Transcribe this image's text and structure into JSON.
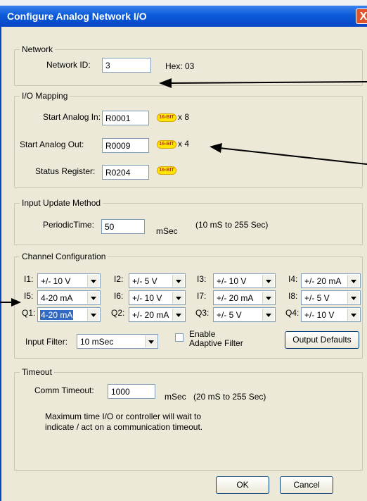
{
  "window": {
    "title": "Configure Analog Network I/O",
    "close_glyph": "X"
  },
  "network": {
    "legend": "Network",
    "id_label": "Network ID:",
    "id_value": "3",
    "hex_label": "Hex: 03"
  },
  "io_mapping": {
    "legend": "I/O Mapping",
    "rows": [
      {
        "label": "Start Analog In:",
        "value": "R0001",
        "badge": "16-BIT",
        "count": "x 8"
      },
      {
        "label": "Start Analog Out:",
        "value": "R0009",
        "badge": "16-BIT",
        "count": "x 4"
      },
      {
        "label": "Status Register:",
        "value": "R0204",
        "badge": "16-BIT",
        "count": ""
      }
    ]
  },
  "input_update": {
    "legend": "Input Update Method",
    "label": "PeriodicTime:",
    "value": "50",
    "unit": "mSec",
    "range": "(10 mS to 255 Sec)"
  },
  "channels": {
    "legend": "Channel Configuration",
    "items": [
      {
        "name": "I1:",
        "value": "+/- 10 V"
      },
      {
        "name": "I2:",
        "value": "+/- 5 V"
      },
      {
        "name": "I3:",
        "value": "+/- 10 V"
      },
      {
        "name": "I4:",
        "value": "+/- 20 mA"
      },
      {
        "name": "I5:",
        "value": "4-20 mA"
      },
      {
        "name": "I6:",
        "value": "+/- 10 V"
      },
      {
        "name": "I7:",
        "value": "+/- 20 mA"
      },
      {
        "name": "I8:",
        "value": "+/- 5 V"
      },
      {
        "name": "Q1:",
        "value": "4-20 mA"
      },
      {
        "name": "Q2:",
        "value": "+/- 20 mA"
      },
      {
        "name": "Q3:",
        "value": "+/- 5 V"
      },
      {
        "name": "Q4:",
        "value": "+/- 10 V"
      }
    ],
    "filter_label": "Input Filter:",
    "filter_value": "10 mSec",
    "adaptive_line1": "Enable",
    "adaptive_line2": "Adaptive Filter",
    "output_defaults": "Output Defaults"
  },
  "timeout": {
    "legend": "Timeout",
    "label": "Comm Timeout:",
    "value": "1000",
    "unit": "mSec",
    "range": "(20 mS to 255 Sec)",
    "note_line1": "Maximum time I/O or controller will wait to",
    "note_line2": "indicate / act on a communication timeout."
  },
  "buttons": {
    "ok": "OK",
    "cancel": "Cancel"
  }
}
